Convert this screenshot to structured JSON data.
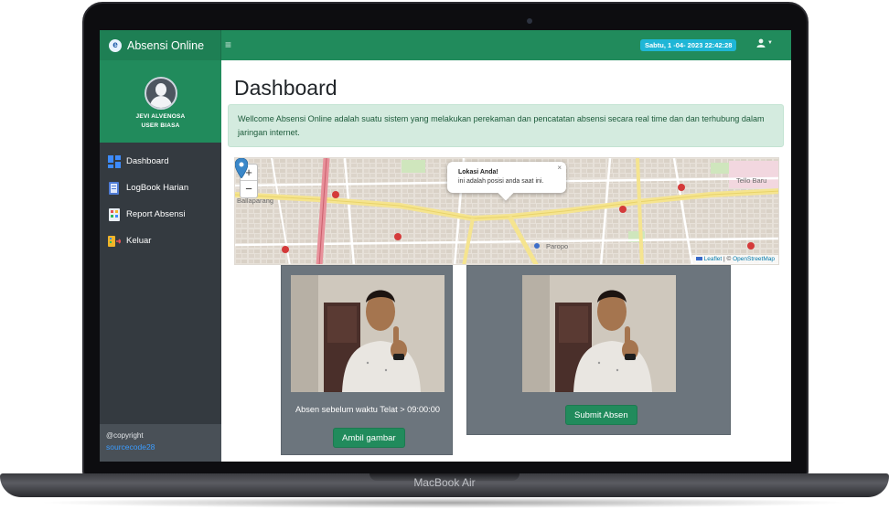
{
  "device": {
    "label": "MacBook Air"
  },
  "app": {
    "title": "Absensi Online",
    "logo_letter": "e",
    "datetime": "Sabtu, 1 -04- 2023 22:42:28",
    "menu_icon": "hamburger-icon",
    "user_icon": "user-icon"
  },
  "profile": {
    "name": "JEVI ALVENOSA",
    "role": "USER BIASA"
  },
  "sidebar": {
    "items": [
      {
        "label": "Dashboard",
        "icon": "dashboard-icon"
      },
      {
        "label": "LogBook Harian",
        "icon": "logbook-icon"
      },
      {
        "label": "Report Absensi",
        "icon": "report-icon"
      },
      {
        "label": "Keluar",
        "icon": "logout-icon"
      }
    ],
    "footer": {
      "copyright": "@copyright",
      "link": "sourcecode28"
    }
  },
  "main": {
    "title": "Dashboard",
    "alert": "Wellcome Absensi Online adalah suatu sistem yang melakukan perekaman dan pencatatan absensi secara real time dan dan terhubung dalam jaringan internet."
  },
  "map": {
    "zoom_in": "+",
    "zoom_out": "−",
    "popup_title": "Lokasi Anda!",
    "popup_text": "ini adalah posisi anda saat ini.",
    "popup_close": "×",
    "labels": [
      "Ballaparang",
      "Paropo",
      "Tello Baru"
    ],
    "attribution": {
      "leaflet": "Leaflet",
      "separator": " | © ",
      "osm": "OpenStreetMap"
    }
  },
  "camera": {
    "status_text": "Absen sebelum waktu Telat > 09:00:00",
    "capture_button": "Ambil gambar",
    "submit_button": "Submit Absen"
  },
  "colors": {
    "primary": "#218b5c",
    "sidebar": "#343a40",
    "alert_bg": "#d4ebdf",
    "badge": "#1fb6d6",
    "card": "#6c757d"
  }
}
